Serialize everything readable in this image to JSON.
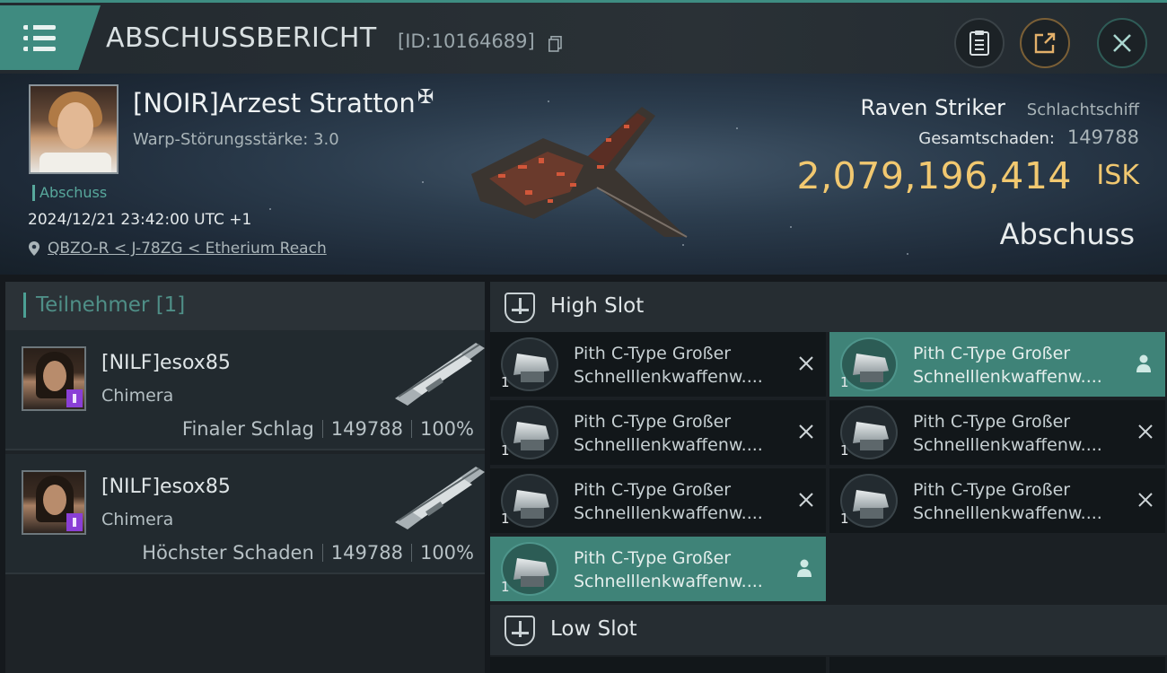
{
  "topbar": {
    "title": "ABSCHUSSBERICHT",
    "report_id": "[ID:10164689]",
    "icons": [
      "menu-icon",
      "copy-icon",
      "clipboard-icon",
      "share-icon",
      "close-icon"
    ]
  },
  "victim": {
    "name": "[NOIR]Arzest Stratton",
    "corp_symbol": "✠",
    "warp_strength": "Warp-Störungsstärke: 3.0",
    "type_tag": "Abschuss",
    "datetime": "2024/12/21 23:42:00 UTC +1",
    "location": "QBZO-R < J-78ZG < Etherium Reach"
  },
  "ship": {
    "name": "Raven Striker",
    "class": "Schlachtschiff",
    "damage_label": "Gesamtschaden:",
    "damage_value": "149788",
    "isk_value": "2,079,196,414",
    "isk_unit": "ISK",
    "result": "Abschuss"
  },
  "participants": {
    "title": "Teilnehmer [1]",
    "rows": [
      {
        "name": "[NILF]esox85",
        "ship": "Chimera",
        "role": "Finaler Schlag",
        "damage": "149788",
        "percent": "100%"
      },
      {
        "name": "[NILF]esox85",
        "ship": "Chimera",
        "role": "Höchster Schaden",
        "damage": "149788",
        "percent": "100%"
      }
    ]
  },
  "slots": {
    "high_title": "High Slot",
    "low_title": "Low Slot",
    "modules": [
      {
        "line1": "Pith C-Type Großer",
        "line2": "Schnelllenkwaffenw....",
        "qty": "1",
        "state": "destroyed"
      },
      {
        "line1": "Pith C-Type Großer",
        "line2": "Schnelllenkwaffenw....",
        "qty": "1",
        "state": "dropped"
      },
      {
        "line1": "Pith C-Type Großer",
        "line2": "Schnelllenkwaffenw....",
        "qty": "1",
        "state": "destroyed"
      },
      {
        "line1": "Pith C-Type Großer",
        "line2": "Schnelllenkwaffenw....",
        "qty": "1",
        "state": "destroyed"
      },
      {
        "line1": "Pith C-Type Großer",
        "line2": "Schnelllenkwaffenw....",
        "qty": "1",
        "state": "destroyed"
      },
      {
        "line1": "Pith C-Type Großer",
        "line2": "Schnelllenkwaffenw....",
        "qty": "1",
        "state": "destroyed"
      },
      {
        "line1": "Pith C-Type Großer",
        "line2": "Schnelllenkwaffenw....",
        "qty": "1",
        "state": "dropped"
      }
    ]
  },
  "colors": {
    "accent": "#3f8b80",
    "isk": "#f1c870",
    "dropped": "#3f8378"
  }
}
